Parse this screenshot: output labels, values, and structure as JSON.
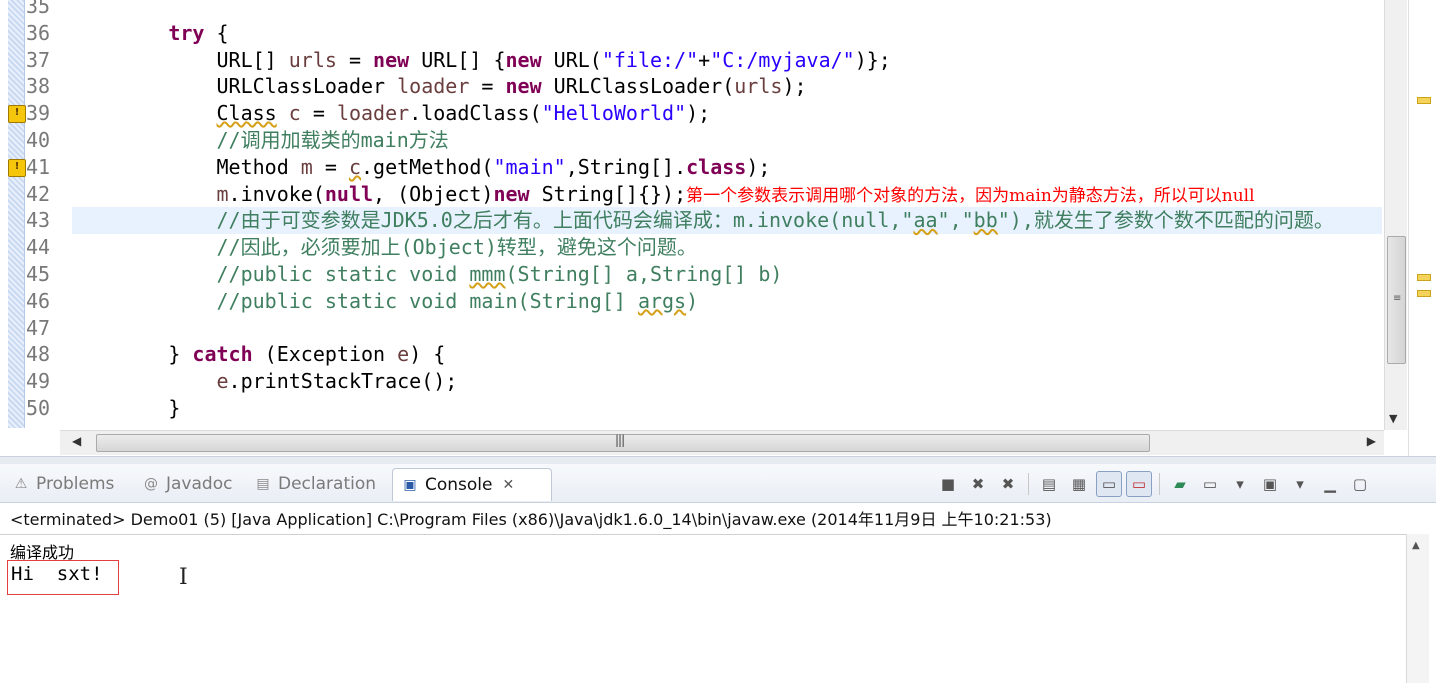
{
  "editor": {
    "line_numbers": [
      "35",
      "36",
      "37",
      "38",
      "39",
      "40",
      "41",
      "42",
      "43",
      "44",
      "45",
      "46",
      "47",
      "48",
      "49",
      "50"
    ],
    "warning_lines": [
      "39",
      "41"
    ],
    "lines": [
      [],
      [
        {
          "t": "        "
        },
        {
          "t": "try",
          "c": "kw"
        },
        {
          "t": " {"
        }
      ],
      [
        {
          "t": "            URL[] "
        },
        {
          "t": "urls",
          "c": "var"
        },
        {
          "t": " = "
        },
        {
          "t": "new",
          "c": "kw"
        },
        {
          "t": " URL[] {"
        },
        {
          "t": "new",
          "c": "kw"
        },
        {
          "t": " URL("
        },
        {
          "t": "\"file:/\"",
          "c": "str"
        },
        {
          "t": "+"
        },
        {
          "t": "\"C:/myjava/\"",
          "c": "str"
        },
        {
          "t": ")};"
        }
      ],
      [
        {
          "t": "            URLClassLoader "
        },
        {
          "t": "loader",
          "c": "var"
        },
        {
          "t": " = "
        },
        {
          "t": "new",
          "c": "kw"
        },
        {
          "t": " URLClassLoader("
        },
        {
          "t": "urls",
          "c": "var"
        },
        {
          "t": ");"
        }
      ],
      [
        {
          "t": "            "
        },
        {
          "t": "Class",
          "c": "warn"
        },
        {
          "t": " "
        },
        {
          "t": "c",
          "c": "var"
        },
        {
          "t": " = "
        },
        {
          "t": "loader",
          "c": "var"
        },
        {
          "t": ".loadClass("
        },
        {
          "t": "\"HelloWorld\"",
          "c": "str"
        },
        {
          "t": ");"
        }
      ],
      [
        {
          "t": "            "
        },
        {
          "t": "//调用加载类的main方法",
          "c": "com"
        }
      ],
      [
        {
          "t": "            Method "
        },
        {
          "t": "m",
          "c": "var"
        },
        {
          "t": " = "
        },
        {
          "t": "c",
          "c": "var warn"
        },
        {
          "t": ".getMethod("
        },
        {
          "t": "\"main\"",
          "c": "str"
        },
        {
          "t": ",String[]."
        },
        {
          "t": "class",
          "c": "kw"
        },
        {
          "t": ");"
        }
      ],
      [
        {
          "t": "            "
        },
        {
          "t": "m",
          "c": "var"
        },
        {
          "t": ".invoke("
        },
        {
          "t": "null",
          "c": "kw"
        },
        {
          "t": ", (Object)"
        },
        {
          "t": "new",
          "c": "kw"
        },
        {
          "t": " String[]{});"
        },
        {
          "t": "第一个参数表示调用哪个对象的方法，因为main为静态方法，所以可以null",
          "c": "note"
        }
      ],
      [
        {
          "t": "            "
        },
        {
          "t": "//由于可变参数是JDK5.0之后才有。上面代码会编译成：m.invoke(null,\"",
          "c": "com"
        },
        {
          "t": "aa",
          "c": "com warn"
        },
        {
          "t": "\",\"",
          "c": "com"
        },
        {
          "t": "bb",
          "c": "com warn"
        },
        {
          "t": "\"),就发生了参数个数不匹配的问题。",
          "c": "com"
        }
      ],
      [
        {
          "t": "            "
        },
        {
          "t": "//因此，必须要加上(Object)转型，避免这个问题。",
          "c": "com"
        }
      ],
      [
        {
          "t": "            "
        },
        {
          "t": "//public static void ",
          "c": "com"
        },
        {
          "t": "mmm",
          "c": "com warn"
        },
        {
          "t": "(String[] a,String[] b)",
          "c": "com"
        }
      ],
      [
        {
          "t": "            "
        },
        {
          "t": "//public static void main(String[] ",
          "c": "com"
        },
        {
          "t": "args",
          "c": "com warn"
        },
        {
          "t": ")",
          "c": "com"
        }
      ],
      [],
      [
        {
          "t": "        } "
        },
        {
          "t": "catch",
          "c": "kw"
        },
        {
          "t": " (Exception "
        },
        {
          "t": "e",
          "c": "var"
        },
        {
          "t": ") {"
        }
      ],
      [
        {
          "t": "            "
        },
        {
          "t": "e",
          "c": "var"
        },
        {
          "t": ".printStackTrace();"
        }
      ],
      [
        {
          "t": "        }"
        }
      ]
    ],
    "current_line_index": 8
  },
  "views": {
    "tabs": [
      {
        "label": "Problems",
        "icon": "problems-icon",
        "glyph": "⚠"
      },
      {
        "label": "Javadoc",
        "icon": "javadoc-icon",
        "glyph": "@"
      },
      {
        "label": "Declaration",
        "icon": "declaration-icon",
        "glyph": "▤"
      },
      {
        "label": "Console",
        "icon": "console-icon",
        "glyph": "▣",
        "active": true
      }
    ],
    "close_glyph": "✕",
    "toolbar": [
      {
        "name": "terminate-icon",
        "glyph": "■"
      },
      {
        "name": "remove-launch-icon",
        "glyph": "✖"
      },
      {
        "name": "remove-all-terminated-icon",
        "glyph": "✖"
      },
      {
        "sep": true
      },
      {
        "name": "clear-console-icon",
        "glyph": "▤"
      },
      {
        "name": "scroll-lock-icon",
        "glyph": "▦"
      },
      {
        "name": "show-on-stdout-icon",
        "glyph": "▭",
        "pressed": true
      },
      {
        "name": "show-on-stderr-icon",
        "glyph": "▭",
        "pressed": true
      },
      {
        "sep": true
      },
      {
        "name": "pin-console-icon",
        "glyph": "▰"
      },
      {
        "name": "display-console-icon",
        "glyph": "▭"
      },
      {
        "name": "display-console-dropdown-icon",
        "glyph": "▾"
      },
      {
        "name": "open-console-icon",
        "glyph": "▣"
      },
      {
        "name": "open-console-dropdown-icon",
        "glyph": "▾"
      },
      {
        "name": "minimize-view-icon",
        "glyph": "▁"
      },
      {
        "name": "maximize-view-icon",
        "glyph": "▢"
      }
    ],
    "process_label": "<terminated> Demo01 (5) [Java Application] C:\\Program Files (x86)\\Java\\jdk1.6.0_14\\bin\\javaw.exe (2014年11月9日 上午10:21:53)",
    "output": {
      "line1": "编译成功",
      "line2": "Hi  sxt!"
    }
  },
  "colors": {
    "keyword": "#7f0055",
    "string": "#2a00ff",
    "comment": "#3f7f5f",
    "annotation": "#ff0000",
    "current_line": "#e8f2fe"
  }
}
